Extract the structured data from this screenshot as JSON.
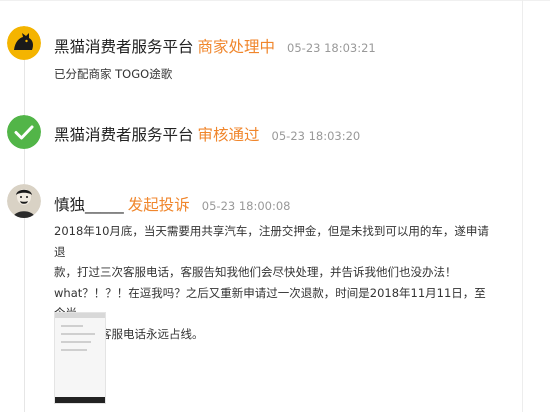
{
  "entries": [
    {
      "avatar_icon": "black-cat-logo-icon",
      "name": "黑猫消费者服务平台",
      "status": "商家处理中",
      "time": "05-23 18:03:21",
      "body": "已分配商家 TOGO途歌"
    },
    {
      "avatar_icon": "green-check-icon",
      "name": "黑猫消费者服务平台",
      "status": "审核通过",
      "time": "05-23 18:03:20"
    },
    {
      "avatar_icon": "user-avatar-icon",
      "name": "慎独_____",
      "status": "发起投诉",
      "time": "05-23 18:00:08",
      "body_line1": "2018年10月底，当天需要用共享汽车，注册交押金，但是未找到可以用的车，遂申请退",
      "body_line2": "款，打过三次客服电话，客服告知我他们会尽快处理，并告诉我他们也没办法！",
      "body_line3": "what？！？！在逗我吗？之后又重新申请过一次退款，时间是2018年11月11日，至今尚",
      "body_line4": "未退还，客服电话永远占线。",
      "attachment_icon": "screenshot-thumbnail-icon"
    }
  ],
  "colors": {
    "status": "#f0862c",
    "time": "#999999",
    "check": "#52b548",
    "line": "#e6e6e6"
  }
}
